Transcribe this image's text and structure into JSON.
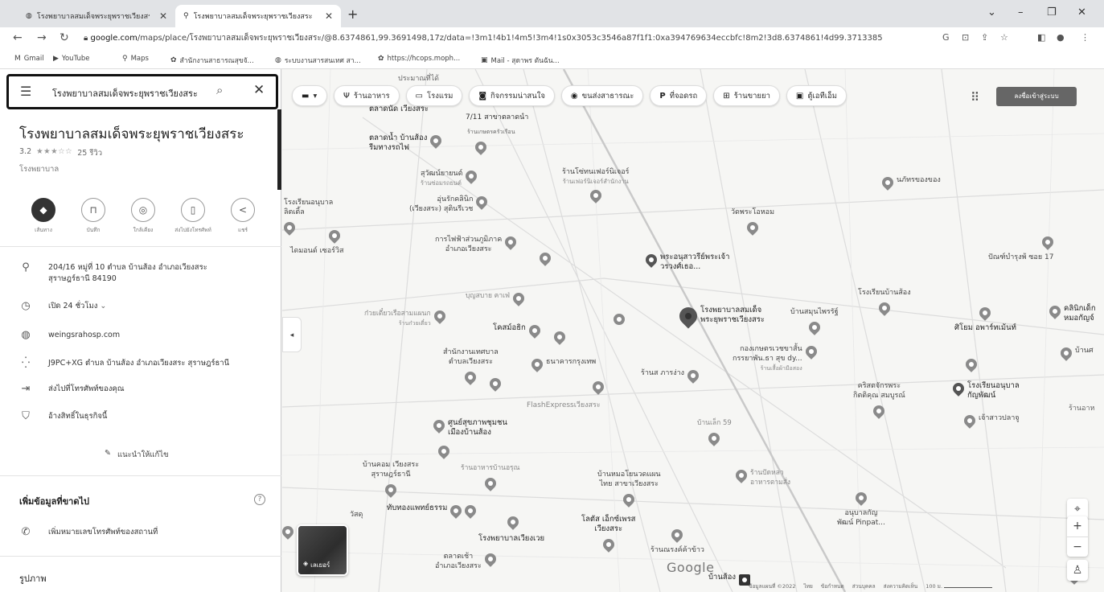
{
  "browser": {
    "tabs": [
      {
        "title": "โรงพยาบาลสมเด็จพระยุพราชเวียงสระ",
        "active": false
      },
      {
        "title": "โรงพยาบาลสมเด็จพระยุพราชเวียงสระ",
        "active": true
      }
    ],
    "url_domain": "google.com",
    "url_rest": "/maps/place/โรงพยาบาลสมเด็จพระยุพราชเวียงสระ/@8.6374861,99.3691498,17z/data=!3m1!4b1!4m5!3m4!1s0x3053c3546a87f1f1:0xa394769634eccbfc!8m2!3d8.6374861!4d99.3713385",
    "bookmarks": [
      "Gmail",
      "YouTube",
      "Maps",
      "สำนักงานสาธารณสุขจั...",
      "ระบบงานสารสนเทศ สา...",
      "https://hcops.moph...",
      "Mail - สุดาพร ตันฉัน..."
    ]
  },
  "panel": {
    "search_value": "โรงพยาบาลสมเด็จพระยุพราชเวียงสระ",
    "title": "โรงพยาบาลสมเด็จพระยุพราชเวียงสระ",
    "rating": "3.2",
    "stars": "★★★☆☆",
    "reviews": "25 รีวิว",
    "category": "โรงพยาบาล",
    "actions": [
      {
        "label": "เส้นทาง",
        "icon": "directions-icon"
      },
      {
        "label": "บันทึก",
        "icon": "bookmark-icon"
      },
      {
        "label": "ใกล้เคียง",
        "icon": "nearby-icon"
      },
      {
        "label": "ส่งไปยังโทรศัพท์",
        "icon": "send-to-phone-icon"
      },
      {
        "label": "แชร์",
        "icon": "share-icon"
      }
    ],
    "address_line1": "204/16 หมู่ที่ 10 ตำบล บ้านส้อง อำเภอเวียงสระ",
    "address_line2": "สุราษฎร์ธานี 84190",
    "hours": "เปิด 24 ชั่วโมง",
    "website": "weingsrahosp.com",
    "plus_code": "J9PC+XG ตำบล บ้านส้อง อำเภอเวียงสระ สุราษฎร์ธานี",
    "send_to_phone": "ส่งไปที่โทรศัพท์ของคุณ",
    "claim": "อ้างสิทธิ์ในธุรกิจนี้",
    "suggest_edit": "แนะนำให้แก้ไข",
    "missing_info": "เพิ่มข้อมูลที่ขาดไป",
    "add_phone": "เพิ่มหมายเลขโทรศัพท์ของสถานที่",
    "photos": "รูปภาพ"
  },
  "map": {
    "chips": [
      {
        "label": "ร้านอาหาร",
        "icon": "fork-knife-icon"
      },
      {
        "label": "โรงแรม",
        "icon": "bed-icon"
      },
      {
        "label": "กิจกรรมน่าสนใจ",
        "icon": "camera-icon"
      },
      {
        "label": "ขนส่งสาธารณะ",
        "icon": "bus-icon"
      },
      {
        "label": "ที่จอดรถ",
        "icon": "parking-icon"
      },
      {
        "label": "ร้านขายยา",
        "icon": "pharmacy-icon"
      },
      {
        "label": "ตู้เอทีเอ็ม",
        "icon": "atm-icon"
      }
    ],
    "signin": "ลงชื่อเข้าสู่ระบบ",
    "layers_label": "เลเยอร์",
    "google": "Google",
    "footer": [
      "ข้อมูลแผนที่ ©2022",
      "ไทย",
      "ข้อกำหนด",
      "ส่วนบุคคล",
      "ส่งความคิดเห็น",
      "100 ม."
    ],
    "pois": {
      "p1": "ประมาณที่ได้",
      "p2": "ตลาดนัด เวียงสระ",
      "p3": "7/11 สาขาตลาดนำ",
      "p4a": "ตลาดน้ำ บ้านส้อง",
      "p4b": "รีมทางรถไฟ",
      "p5": "ร้านเกษตรครัวเรือน",
      "p6a": "สุวัฒน์ยายนต์",
      "p6b": "ร้านซ่อมรถยนต์",
      "p7a": "ร้านโซ่ทนเฟอร์นิเจอร์",
      "p7b": "ร้านเฟอร์นิเจอร์สำนักงาน",
      "p8a": "อุ่นรักคลินิก",
      "p8b": "(เวียงสระ) สุตินรีเวช",
      "p9a": "โรงเรียนอนุบาล",
      "p9b": "ลิตเติ้ล",
      "p10": "ไดมอนด์ เซอร์วิส",
      "p11": "วัดพระโอหอม",
      "p12": "นภัทรของของ",
      "p13a": "การไฟฟ้าส่วนภูมิภาค",
      "p13b": "อำเภอเวียงสระ",
      "p14a": "พระอนุสาวรีย์พระเจ้า",
      "p14b": "วรวงศ์เธอ...",
      "p15": "ปัณฑ์บำรุงพ้ ซอย 17",
      "p16": "บุญสบาย คาเฟ่",
      "p17": "โรงเรียนบ้านส้อง",
      "p18a": "ก๋วยเตี๋ยวเรือสามแผนก",
      "p18b": "ร้านก๋วยเตี๋ยว",
      "p19": "โคสม์อธิก",
      "p20a": "โรงพยาบาลสมเด็จ",
      "p20b": "พระยุพราชเวียงสระ",
      "p21": "บ้านสมุนไพรรัฐ์",
      "p22": "ศิโยม อพาร์ทเม้นท์",
      "p23a": "คลินิกเด็ก",
      "p23b": "หมอกัญจ์",
      "p24a": "สำนักงานเทศบาล",
      "p24b": "ตำบลเวียงสระ",
      "p25": "ธนาคารกรุงเทพ",
      "p26a": "กองเกษตรเวชขาสั้น",
      "p26b": "กรรยาพัน.ธา สุข dy...",
      "p26c": "ร้านเสื้อผ้ามือสอง",
      "p27": "บ้านศ",
      "p28": "ร้านส ภารง่าง",
      "p29": "FlashExpressเวียงสระ",
      "p30a": "คริสตจักรพระ",
      "p30b": "กิตติคุณ สมบูรณ์",
      "p31a": "โรงเรียนอนุบาล",
      "p31b": "กัญพัฒน์",
      "p32": "ร้านอาห",
      "p33": "เจ้าสาวปลาจู",
      "p34": "บ้านเล็ก 59",
      "p35a": "ศูนย์สุขภาพชุมชน",
      "p35b": "เมืองบ้านส้อง",
      "p36a": "บ้านคอม เวียงสระ",
      "p36b": "สุราษฎร์ธานี",
      "p37": "ร้านอาหารบ้านอรุณ",
      "p38a": "บ้านหมอโยนวดแผน",
      "p38b": "ไทย สาขาเวียงสระ",
      "p39a": "ร้านปัดหลา",
      "p39b": "อาหารตามสั่ง",
      "p40a": "อนุบาลกัญ",
      "p40b": "พัฒน์ Pinpat...",
      "p41": "ทับทองแพทย์ธรรม",
      "p42a": "โลตัส เอ็กซ์เพรส",
      "p42b": "เวียงสระ",
      "p43": "โรงพยาบาลเวียงเวย",
      "p44": "ร้านณรงค์ค้าข้าว",
      "p45a": "ตลาดเช้า",
      "p45b": "อำเภอเวียงสระ",
      "p46": "บ้านส้อง",
      "p47": "วัสดุ"
    }
  }
}
